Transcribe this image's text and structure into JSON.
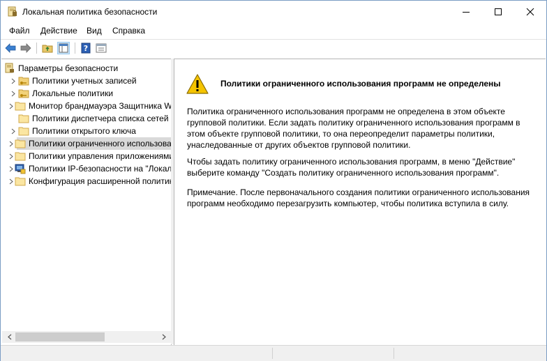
{
  "window": {
    "title": "Локальная политика безопасности"
  },
  "menu": [
    "Файл",
    "Действие",
    "Вид",
    "Справка"
  ],
  "tree": {
    "root": "Параметры безопасности",
    "items": [
      {
        "label": "Политики учетных записей",
        "icon": "folder-key-icon"
      },
      {
        "label": "Локальные политики",
        "icon": "folder-key-icon"
      },
      {
        "label": "Монитор брандмауэра Защитника Windows",
        "icon": "folder-icon"
      },
      {
        "label": "Политики диспетчера списка сетей",
        "icon": "folder-icon"
      },
      {
        "label": "Политики открытого ключа",
        "icon": "folder-icon"
      },
      {
        "label": "Политики ограниченного использования программ",
        "icon": "folder-icon",
        "selected": true
      },
      {
        "label": "Политики управления приложениями",
        "icon": "folder-icon"
      },
      {
        "label": "Политики IP-безопасности на \"Локальный компьютер\"",
        "icon": "ipsec-icon"
      },
      {
        "label": "Конфигурация расширенной политики аудита",
        "icon": "folder-icon"
      }
    ]
  },
  "content": {
    "heading": "Политики ограниченного использования программ не определены",
    "para1": "Политика ограниченного использования программ не определена в этом объекте групповой политики. Если задать политику ограниченного использования программ в этом объекте групповой политики, то она переопределит параметры политики, унаследованные от других объектов групповой политики.",
    "para2": "Чтобы задать политику ограниченного использования программ, в меню \"Действие\" выберите команду \"Создать политику ограниченного использования программ\".",
    "para3": "Примечание. После первоначального создания политики ограниченного использования программ необходимо перезагрузить компьютер, чтобы политика вступила в силу."
  },
  "colors": {
    "selection": "#d9d9d9",
    "warning": "#f5c400",
    "border": "#b5b5b5"
  }
}
